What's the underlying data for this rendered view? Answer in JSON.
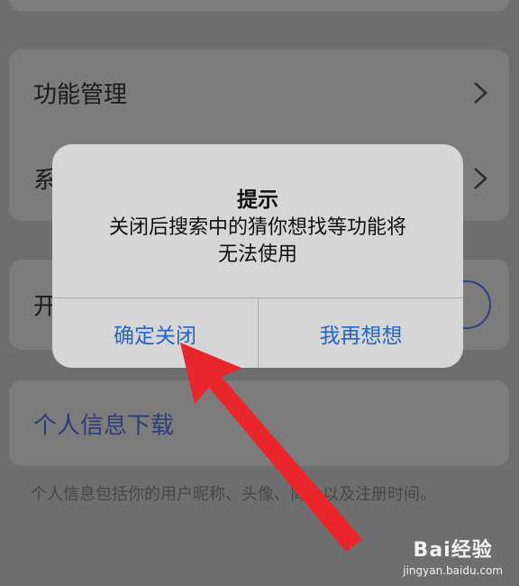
{
  "settings": {
    "items": [
      {
        "label": "功能管理"
      },
      {
        "label": "系"
      },
      {
        "label": "开"
      }
    ],
    "download_label": "个人信息下载",
    "footnote": "个人信息包括你的用户昵称、头像、简介以及注册时间。"
  },
  "dialog": {
    "title": "提示",
    "message_line1": "关闭后搜索中的猜你想找等功能将",
    "message_line2": "无法使用",
    "confirm_label": "确定关闭",
    "cancel_label": "我再想想"
  },
  "annotation": {
    "arrow_color": "#e8262c"
  },
  "watermark": {
    "logo": "Bai经验",
    "url": "jingyan.baidu.com"
  },
  "icons": [
    "chevron-right-icon",
    "toggle-switch-icon",
    "red-arrow-annotation"
  ],
  "colors": {
    "accent": "#2667c5",
    "link": "#2d3c78"
  }
}
